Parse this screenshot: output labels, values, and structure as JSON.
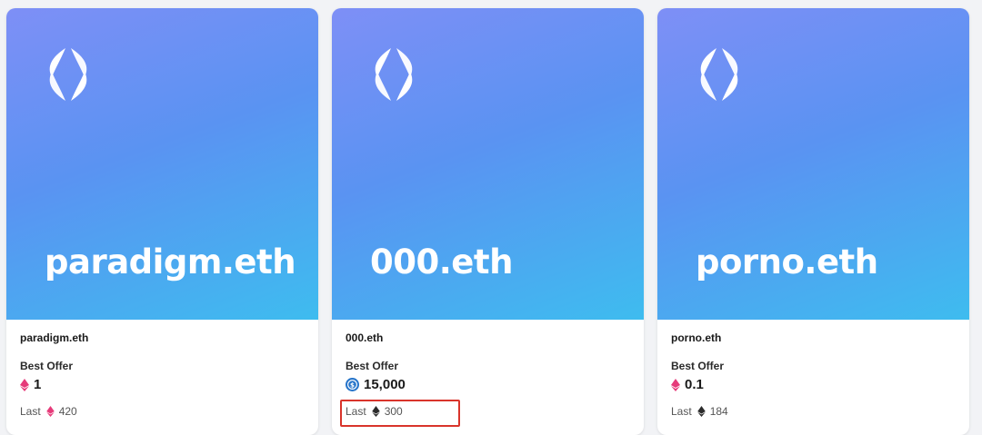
{
  "cards": [
    {
      "name": "paradigm.eth",
      "art_text": "paradigm.eth",
      "best_offer_label": "Best Offer",
      "best_offer_value": "1",
      "best_offer_currency_icon": "eth-pink-icon",
      "last_label": "Last",
      "last_value": "420",
      "last_currency_icon": "eth-pink-icon"
    },
    {
      "name": "000.eth",
      "art_text": "000.eth",
      "best_offer_label": "Best Offer",
      "best_offer_value": "15,000",
      "best_offer_currency_icon": "usdc-icon",
      "last_label": "Last",
      "last_value": "300",
      "last_currency_icon": "eth-dark-icon"
    },
    {
      "name": "porno.eth",
      "art_text": "porno.eth",
      "best_offer_label": "Best Offer",
      "best_offer_value": "0.1",
      "best_offer_currency_icon": "eth-pink-icon",
      "last_label": "Last",
      "last_value": "184",
      "last_currency_icon": "eth-dark-icon"
    }
  ],
  "colors": {
    "gradient_start": "#7e8ff6",
    "gradient_end": "#3ebcef",
    "eth_pink": "#e63b7a",
    "eth_dark": "#2b2b2b",
    "usdc_blue": "#2775ca",
    "highlight_red": "#d9342b"
  }
}
